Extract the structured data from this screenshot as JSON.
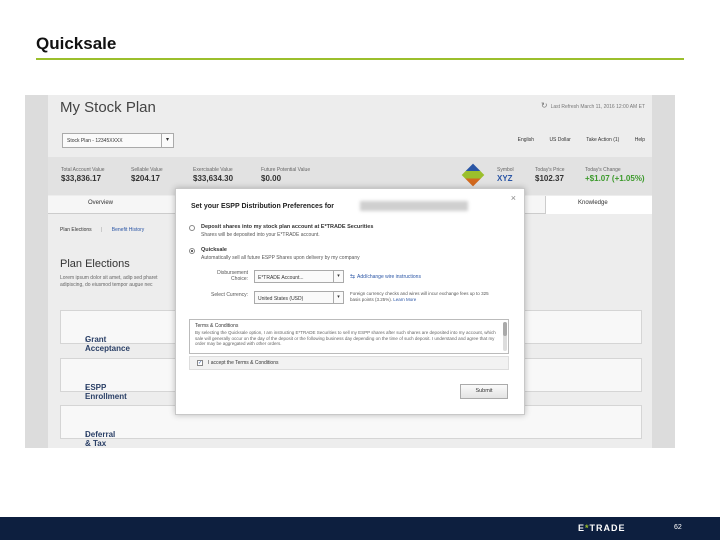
{
  "slide": {
    "title": "Quicksale",
    "page_number": "62",
    "logo_prefix": "E",
    "logo_star": "*",
    "logo_suffix": "TRADE"
  },
  "app": {
    "title": "My Stock Plan",
    "refresh_text": "Last Refresh March 11, 2016 12:00 AM ET",
    "plan_select": "Stock Plan - 12345XXXX",
    "language": "English",
    "currency": "US Dollar",
    "take_action": "Take Action (1)",
    "help": "Help",
    "metrics": [
      {
        "label": "Total Account Value",
        "value": "$33,836.17"
      },
      {
        "label": "Sellable Value",
        "value": "$204.17"
      },
      {
        "label": "Exercisable Value",
        "value": "$33,634.30"
      },
      {
        "label": "Future Potential Value",
        "value": "$0.00"
      },
      {
        "label": "Symbol",
        "value": "XYZ"
      },
      {
        "label": "Today's Price",
        "value": "$102.37"
      },
      {
        "label": "Today's Change",
        "value": "+$1.07 (+1.05%)"
      }
    ],
    "tab_overview": "Overview",
    "tab_knowledge": "Knowledge",
    "subnav_plan_elections": "Plan Elections",
    "subnav_sep": "|",
    "subnav_benefit": "Benefit History",
    "plan_heading": "Plan Elections",
    "plan_desc": "Lorem ipsum dolor sit amet, adip sed pharet adipiscing, do eiusmod tempor augue nec",
    "sections": [
      "Grant Acceptance",
      "ESPP Enrollment",
      "Deferral & Tax Payment Elections"
    ]
  },
  "modal": {
    "title": "Set your ESPP Distribution Preferences for",
    "close": "×",
    "option1_title": "Deposit shares into my stock plan account at E*TRADE Securities",
    "option1_sub": "Shares will be deposited into your E*TRADE account.",
    "option2_title": "Quicksale",
    "option2_sub": "Automatically sell all future ESPP Shares upon delivery by my company",
    "disbursement_label": "Disbursement Choice:",
    "disbursement_value": "E*TRADE Account...",
    "wire_link": "Add/change wire instructions",
    "currency_label": "Select Currency:",
    "currency_value": "United States (USD)",
    "note": "Foreign currency checks and wires will incur exchange fees up to 325 basis points (3.25%).",
    "learn_more": "Learn More",
    "terms_title": "Terms & Conditions",
    "terms_body": "By selecting the Quicksale option, I am instructing E*TRADE Securities to sell my ESPP shares after such shares are deposited into my account, which sale will generally occur on the day of the deposit or the following business day depending on the time of such deposit. I understand and agree that my order may be aggregated with other orders.",
    "accept_label": "I accept the Terms & Conditions",
    "submit": "Submit"
  }
}
